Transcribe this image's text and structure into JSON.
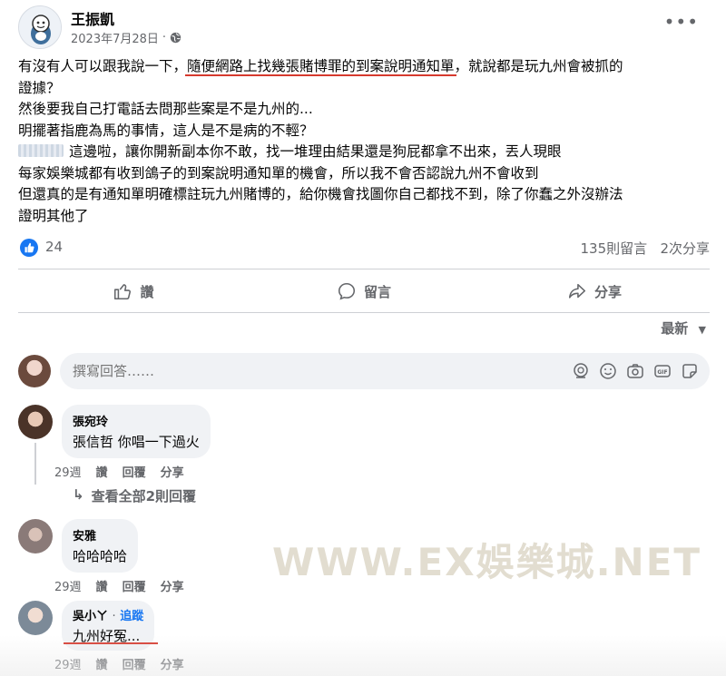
{
  "post": {
    "author": "王振凱",
    "date": "2023年7月28日",
    "meta_sep": "·",
    "more_label": "•••",
    "body": {
      "line1_pre": "有沒有人可以跟我說一下，",
      "line1_hl": "隨便網路上找幾張賭博罪的到案說明通知單",
      "line1_post": "，就說都是玩九州會被抓的",
      "line2": "證據？",
      "line3": "然後要我自己打電話去問那些案是不是九州的...",
      "line4": "明擺著指鹿為馬的事情，這人是不是病的不輕？",
      "line5": "這邊啦，讓你開新副本你不敢，找一堆理由結果還是狗屁都拿不出來，丟人現眼",
      "line6": "每家娛樂城都有收到鴿子的到案說明通知單的機會，所以我不會否認說九州不會收到",
      "line7": "但還真的是有通知單明確標註玩九州賭博的，給你機會找圖你自己都找不到，除了你蠢之外沒辦法",
      "line8": "證明其他了"
    },
    "likes": "24",
    "comments_count": "135則留言",
    "shares_count": "2次分享"
  },
  "actions": {
    "like": "讚",
    "comment": "留言",
    "share": "分享"
  },
  "sort_label": "最新",
  "compose": {
    "placeholder": "撰寫回答……"
  },
  "comments": [
    {
      "name": "張宛玲",
      "text": "張信哲 你唱一下過火",
      "time": "29週",
      "like": "讚",
      "reply": "回覆",
      "share": "分享"
    },
    {
      "name": "安雅",
      "text": "哈哈哈哈",
      "time": "29週",
      "like": "讚",
      "reply": "回覆",
      "share": "分享"
    },
    {
      "name": "吳小ㄚ",
      "follow": "追蹤",
      "sep": "·",
      "text": "九州好冤...",
      "time": "29週",
      "like": "讚",
      "reply": "回覆",
      "share": "分享"
    }
  ],
  "view_replies": "查看全部2則回覆",
  "watermark": "WWW.EX娛樂城.NET",
  "colors": {
    "accent": "#1877f2",
    "annotation_red": "#d63a2e",
    "secondary_text": "#65676b",
    "bubble_bg": "#f0f2f5"
  }
}
